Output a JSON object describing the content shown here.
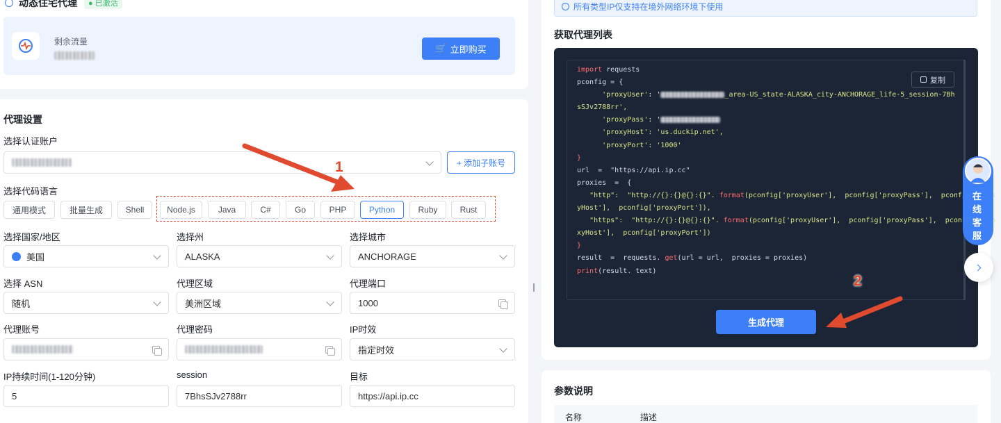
{
  "header": {
    "title": "动态住宅代理",
    "status_badge": "已激活"
  },
  "traffic": {
    "label": "剩余流量",
    "buy_button": "立即购买"
  },
  "settings": {
    "title": "代理设置",
    "account_label": "选择认证账户",
    "add_sub_button": "+ 添加子账号",
    "lang_label": "选择代码语言",
    "modes": [
      "通用模式",
      "批量生成",
      "Shell"
    ],
    "languages": [
      "Node.js",
      "Java",
      "C#",
      "Go",
      "PHP",
      "Python",
      "Ruby",
      "Rust"
    ],
    "selected_language": "Python",
    "country_label": "选择国家/地区",
    "country_value": "美国",
    "state_label": "选择州",
    "state_value": "ALASKA",
    "city_label": "选择城市",
    "city_value": "ANCHORAGE",
    "asn_label": "选择 ASN",
    "asn_value": "随机",
    "region_label": "代理区域",
    "region_value": "美洲区域",
    "port_label": "代理端口",
    "port_value": "1000",
    "user_label": "代理账号",
    "pass_label": "代理密码",
    "ip_validity_label": "IP时效",
    "ip_validity_value": "指定时效",
    "duration_label": "IP持续时间(1-120分钟)",
    "duration_value": "5",
    "session_label": "session",
    "session_value": "7BhsSJv2788rr",
    "target_label": "目标",
    "target_value": "https://api.ip.cc"
  },
  "right": {
    "notice": "所有类型IP仅支持在境外网络环境下使用",
    "list_title": "获取代理列表",
    "copy_button": "复制",
    "generate_button": "生成代理",
    "params_title": "参数说明",
    "params_columns": [
      "名称",
      "描述"
    ]
  },
  "code": {
    "l1_kw": "import",
    "l1_rest": " requests",
    "l2": "pconfig = {",
    "l3_key": "'proxyUser'",
    "l3_val_tail": "_area-US_state-ALASKA_city-ANCHORAGE_life-5_session-7Bh",
    "l4": "sSJv2788rr',",
    "l5_key": "'proxyPass'",
    "l6": "'proxyHost': 'us.duckip.net',",
    "l7": "'proxyPort': '1000'",
    "l8": "}",
    "l9": "url  =  \"https://api.ip.cc\"",
    "l10": "proxies  =  {",
    "l11a": "\"http\":  \"http://{}:{}@{}:{}\". ",
    "l11b": "format",
    "l11c": "(pconfig['proxyUser'],  pconfig['proxyPass'],  pconfig['prox",
    "l12": "yHost'],  pconfig['proxyPort']),",
    "l13a": "\"https\":  \"http://{}:{}@{}:{}\". ",
    "l13b": "format",
    "l13c": "(pconfig['proxyUser'],  pconfig['proxyPass'],  pconfig['pro",
    "l14": "xyHost'],  pconfig['proxyPort'])",
    "l15": "}",
    "l16a": "result  =  requests. ",
    "l16b": "get",
    "l16c": "(url = url,  proxies = proxies)",
    "l17a": "print",
    "l17b": "(result. text)"
  },
  "annotations": {
    "marker_1": "1",
    "marker_2": "2"
  },
  "support": {
    "label": "在线客服"
  },
  "colors": {
    "primary": "#3d7ff6",
    "code_bg": "#1c2536",
    "annotation_red": "#e04a2f",
    "badge_green": "#3bb96b"
  }
}
